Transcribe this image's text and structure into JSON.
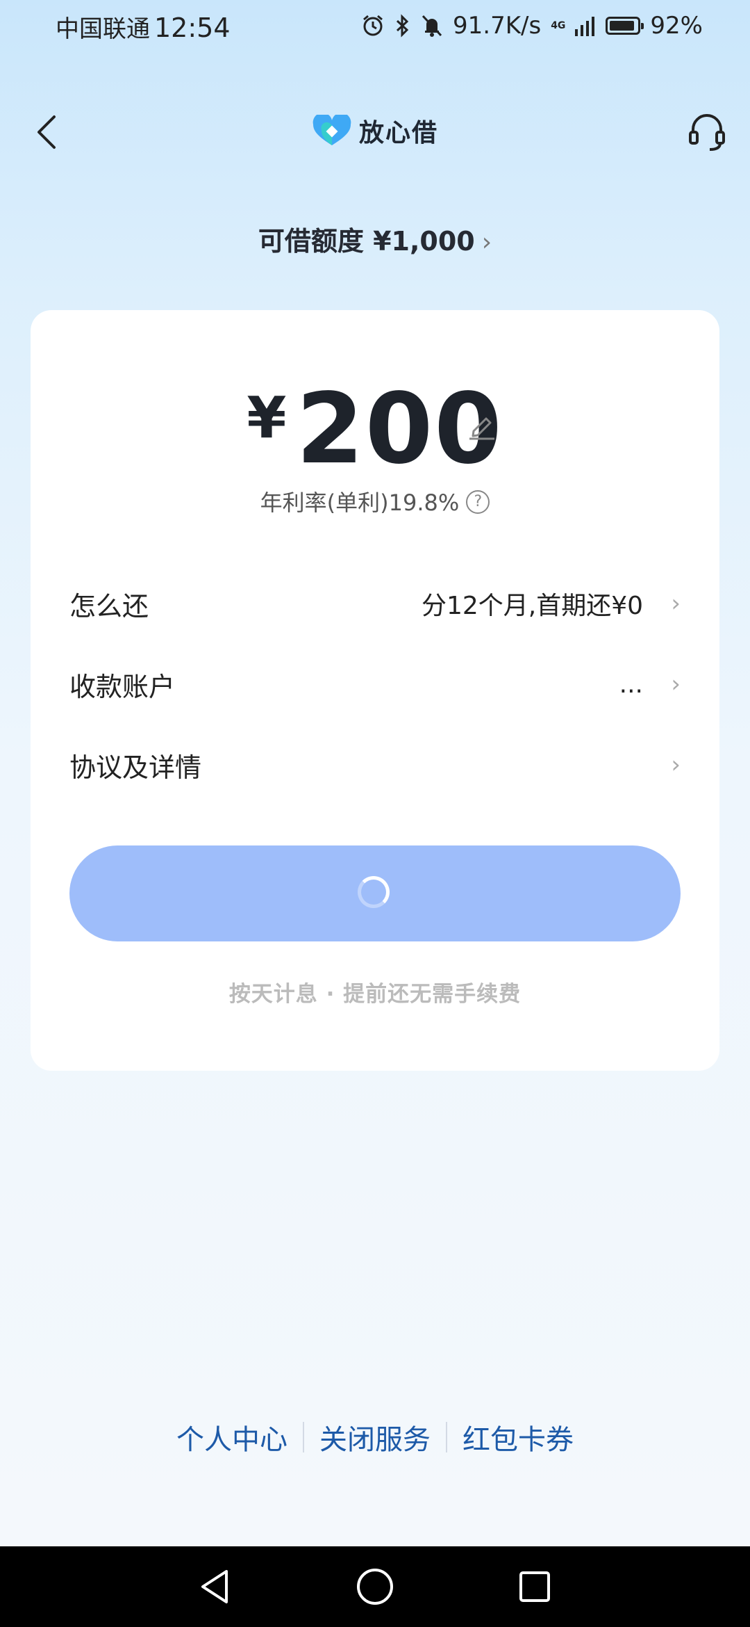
{
  "status_bar": {
    "carrier": "中国联通",
    "time": "12:54",
    "net_speed": "91.7K/s",
    "network_type": "4G",
    "battery_text": "92%",
    "battery_level": 0.92,
    "icons": [
      "alarm-icon",
      "bluetooth-icon",
      "mute-icon",
      "signal-icon",
      "battery-icon"
    ]
  },
  "header": {
    "brand_name": "放心借",
    "back_icon": "back-arrow-icon",
    "support_icon": "headset-icon"
  },
  "limit": {
    "label": "可借额度 ¥1,000",
    "chevron": "›"
  },
  "loan": {
    "currency": "¥",
    "amount": "200",
    "edit_icon": "pencil-icon",
    "rate": "年利率(单利)19.8%",
    "help_glyph": "?"
  },
  "rows": [
    {
      "label": "怎么还",
      "value": "分12个月,首期还¥0"
    },
    {
      "label": "收款账户",
      "value": "..."
    },
    {
      "label": "协议及详情",
      "value": ""
    }
  ],
  "submit": {
    "state": "loading"
  },
  "tip": "按天计息 · 提前还无需手续费",
  "footer_links": [
    "个人中心",
    "关闭服务",
    "红包卡券"
  ],
  "colors": {
    "accent_button": "#9ebdfa",
    "link": "#1d5aa8",
    "brand_blue": "#2f8cf0"
  }
}
